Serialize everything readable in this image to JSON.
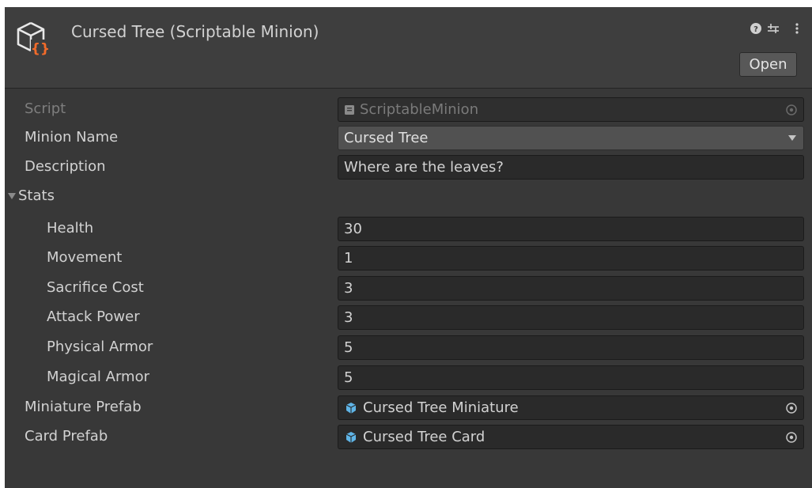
{
  "header": {
    "title": "Cursed Tree (Scriptable Minion)",
    "open_label": "Open",
    "icons": [
      "scriptable-object-icon",
      "help-icon",
      "preset-sliders-icon",
      "kebab-menu-icon"
    ]
  },
  "fields": {
    "script": {
      "label": "Script",
      "value": "ScriptableMinion"
    },
    "minion_name": {
      "label": "Minion Name",
      "value": "Cursed Tree"
    },
    "description": {
      "label": "Description",
      "value": "Where are the leaves?"
    },
    "stats": {
      "label": "Stats",
      "health": {
        "label": "Health",
        "value": "30"
      },
      "movement": {
        "label": "Movement",
        "value": "1"
      },
      "sacrifice_cost": {
        "label": "Sacrifice Cost",
        "value": "3"
      },
      "attack_power": {
        "label": "Attack Power",
        "value": "3"
      },
      "physical_armor": {
        "label": "Physical Armor",
        "value": "5"
      },
      "magical_armor": {
        "label": "Magical Armor",
        "value": "5"
      }
    },
    "miniature_prefab": {
      "label": "Miniature Prefab",
      "value": "Cursed Tree Miniature"
    },
    "card_prefab": {
      "label": "Card Prefab",
      "value": "Cursed Tree Card"
    }
  },
  "colors": {
    "panel_bg": "#383838",
    "header_bg": "#3e3e3e",
    "field_bg": "#2a2a2a",
    "accent_orange": "#f26b2a",
    "prefab_blue": "#5fb4e6"
  }
}
